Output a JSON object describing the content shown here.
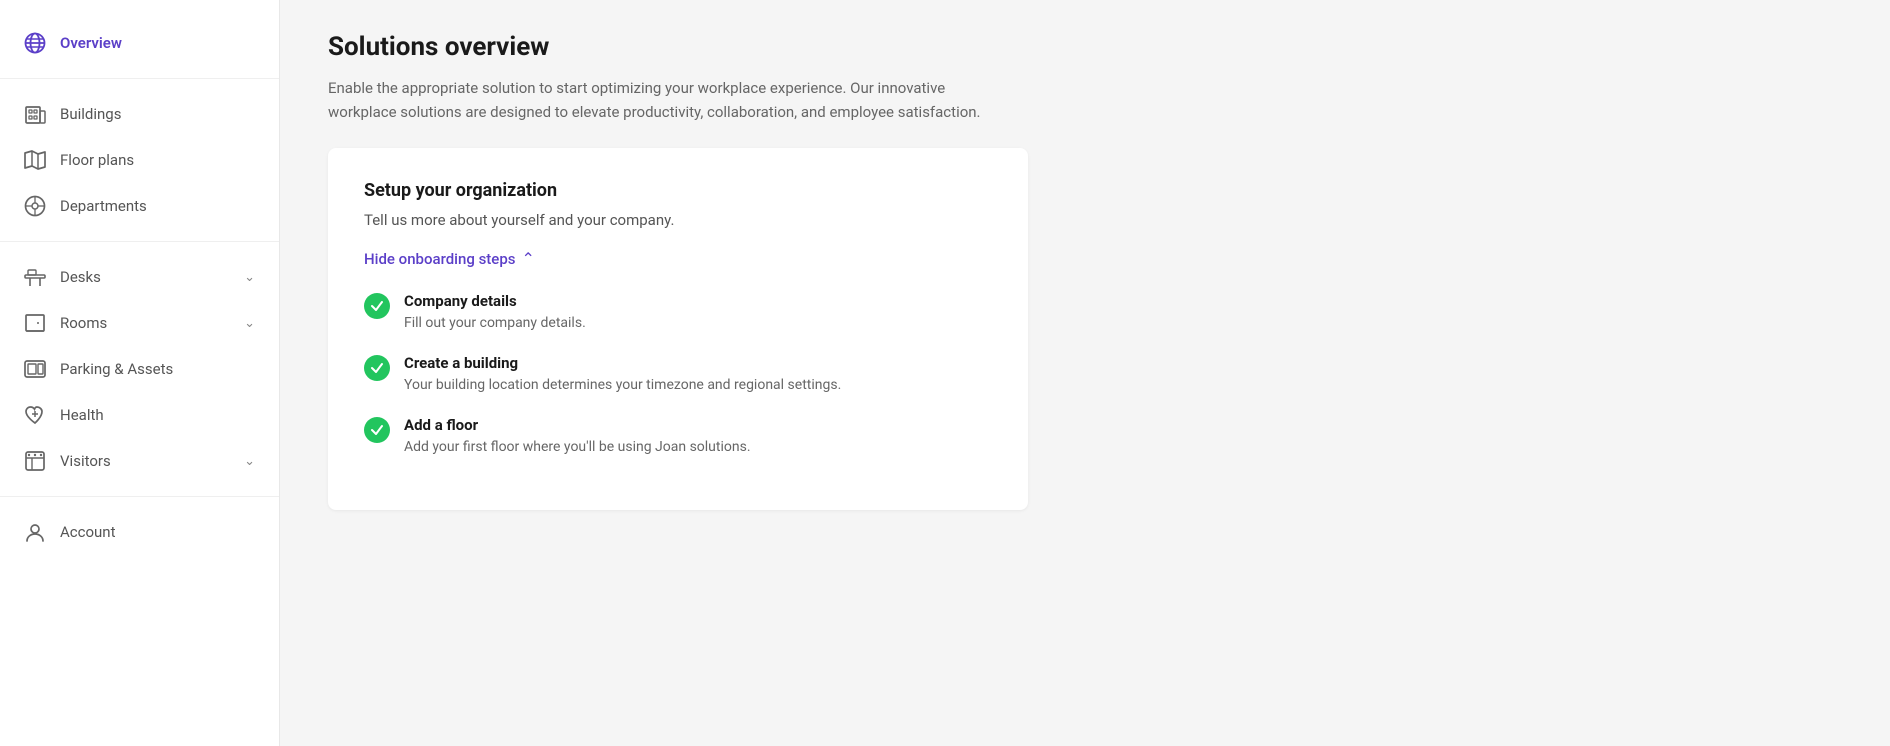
{
  "sidebar": {
    "items": [
      {
        "id": "overview",
        "label": "Overview",
        "icon": "globe",
        "active": true,
        "hasChevron": false
      },
      {
        "id": "buildings",
        "label": "Buildings",
        "icon": "buildings",
        "active": false,
        "hasChevron": false
      },
      {
        "id": "floor-plans",
        "label": "Floor plans",
        "icon": "map",
        "active": false,
        "hasChevron": false
      },
      {
        "id": "departments",
        "label": "Departments",
        "icon": "departments",
        "active": false,
        "hasChevron": false
      },
      {
        "id": "desks",
        "label": "Desks",
        "icon": "desks",
        "active": false,
        "hasChevron": true
      },
      {
        "id": "rooms",
        "label": "Rooms",
        "icon": "rooms",
        "active": false,
        "hasChevron": true
      },
      {
        "id": "parking-assets",
        "label": "Parking & Assets",
        "icon": "parking",
        "active": false,
        "hasChevron": false
      },
      {
        "id": "health",
        "label": "Health",
        "icon": "health",
        "active": false,
        "hasChevron": false
      },
      {
        "id": "visitors",
        "label": "Visitors",
        "icon": "visitors",
        "active": false,
        "hasChevron": true
      },
      {
        "id": "account",
        "label": "Account",
        "icon": "account",
        "active": false,
        "hasChevron": false
      }
    ]
  },
  "main": {
    "page_title": "Solutions overview",
    "page_description": "Enable the appropriate solution to start optimizing your workplace experience. Our innovative workplace solutions are designed to elevate productivity, collaboration, and employee satisfaction.",
    "card": {
      "title": "Setup your organization",
      "subtitle": "Tell us more about yourself and your company.",
      "hide_label": "Hide onboarding steps",
      "steps": [
        {
          "title": "Company details",
          "description": "Fill out your company details.",
          "completed": true
        },
        {
          "title": "Create a building",
          "description": "Your building location determines your timezone and regional settings.",
          "completed": true
        },
        {
          "title": "Add a floor",
          "description": "Add your first floor where you'll be using Joan solutions.",
          "completed": true
        }
      ]
    }
  },
  "colors": {
    "accent": "#5b3fc8",
    "success": "#22c55e",
    "text_primary": "#1a1a1a",
    "text_secondary": "#555",
    "text_muted": "#666"
  }
}
